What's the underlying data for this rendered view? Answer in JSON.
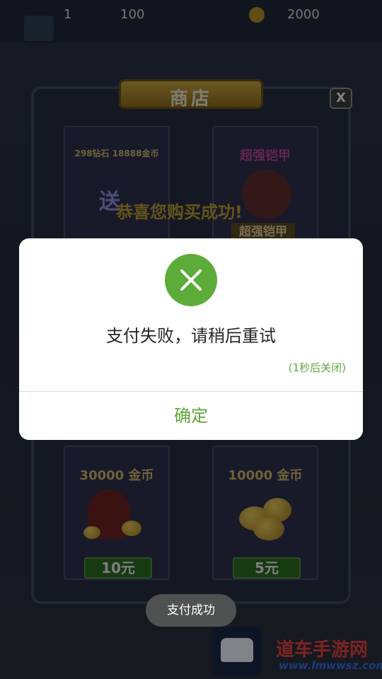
{
  "background_game": {
    "top_bar": {
      "stat_1": "1",
      "stat_2": "100",
      "stat_3": "2000"
    },
    "shop": {
      "title": "商店",
      "close_label": "X",
      "cards": [
        {
          "label": "298钻石 18888金币",
          "price": ""
        },
        {
          "label": "超强铠甲",
          "price": ""
        },
        {
          "label": "30000 金币",
          "price": "10元"
        },
        {
          "label": "10000 金币",
          "price": "5元"
        }
      ],
      "promo_text": "恭喜您购买成功!",
      "gift_badge": "送",
      "armor_label": "超强铠甲"
    },
    "watermark": {
      "site_name": "道车手游网",
      "site_url": "www.lmwwsz.com"
    }
  },
  "dialog": {
    "icon": "close-x-icon",
    "message": "支付失败，请稍后重试",
    "countdown": "(1秒后关闭)",
    "confirm_label": "确定"
  },
  "toast": {
    "message": "支付成功"
  },
  "colors": {
    "accent_green": "#5fa83b",
    "icon_green": "#5dac3a",
    "text_dark": "#262626",
    "overlay": "rgba(0,0,0,0.45)"
  }
}
